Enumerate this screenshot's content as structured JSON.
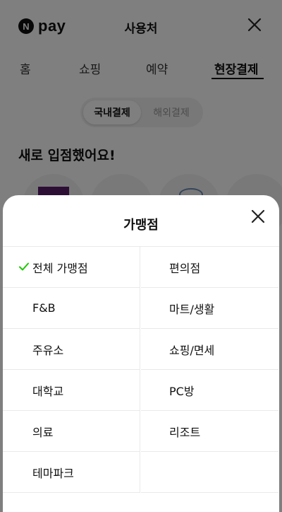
{
  "header": {
    "logo_badge": "N",
    "logo_text": "pay",
    "title": "사용처"
  },
  "tabs": [
    {
      "label": "홈",
      "active": false
    },
    {
      "label": "쇼핑",
      "active": false
    },
    {
      "label": "예약",
      "active": false
    },
    {
      "label": "현장결제",
      "active": true
    }
  ],
  "segmented": {
    "options": [
      "국내결제",
      "해외결제"
    ],
    "selected": "국내결제"
  },
  "section": {
    "title": "새로 입점했어요!"
  },
  "sheet": {
    "title": "가맹점",
    "selected": "전체 가맹점",
    "check_color": "#1ec800",
    "items": [
      "전체 가맹점",
      "편의점",
      "F&B",
      "마트/생활",
      "주유소",
      "쇼핑/면세",
      "대학교",
      "PC방",
      "의료",
      "리조트",
      "테마파크"
    ]
  }
}
